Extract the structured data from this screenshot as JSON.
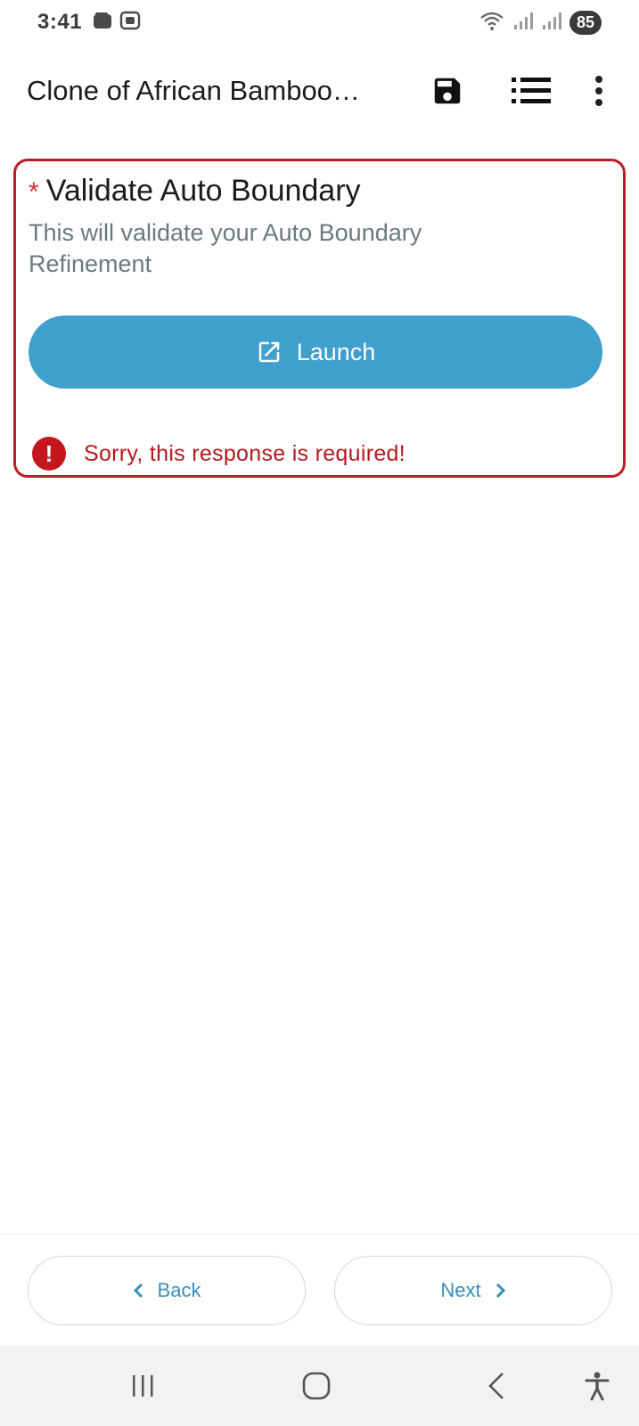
{
  "status_bar": {
    "time": "3:41",
    "battery": "85",
    "icons": [
      "wallet-icon",
      "screenshot-icon",
      "wifi-icon",
      "signal-icon",
      "signal-icon"
    ]
  },
  "app_bar": {
    "title": "Clone of African Bamboo…",
    "actions": [
      "save-icon",
      "list-icon",
      "more-vert-icon"
    ]
  },
  "question": {
    "required_mark": "*",
    "title": "Validate Auto Boundary",
    "hint": "This will validate your Auto Boundary Refinement",
    "launch_label": "Launch",
    "error_text": "Sorry, this response is required!"
  },
  "navigation": {
    "back_label": "Back",
    "next_label": "Next"
  },
  "colors": {
    "accent": "#3f9fcd",
    "error": "#b81e25",
    "nav_text": "#3a8fb8"
  }
}
